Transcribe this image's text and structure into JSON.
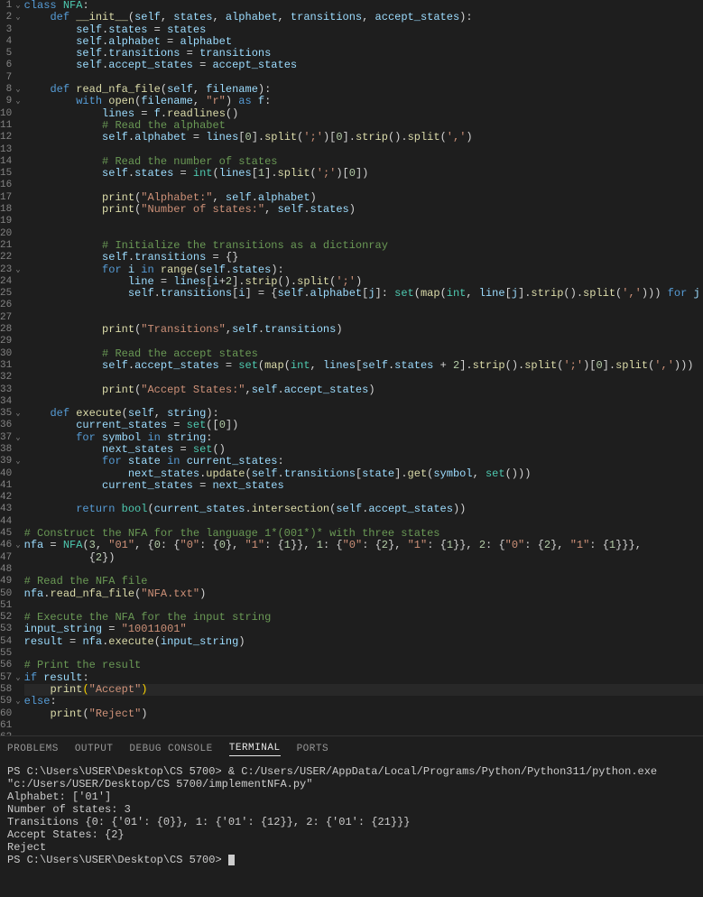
{
  "gutter_lines": 62,
  "fold_lines": [
    1,
    2,
    8,
    9,
    23,
    35,
    37,
    39,
    46,
    57,
    59
  ],
  "code_lines": [
    "<span class='kw'>class</span> <span class='cls'>NFA</span>:",
    "    <span class='kw'>def</span> <span class='fn'>__init__</span>(<span class='self'>self</span>, <span class='var'>states</span>, <span class='var'>alphabet</span>, <span class='var'>transitions</span>, <span class='var'>accept_states</span>):",
    "        <span class='self'>self</span>.<span class='var'>states</span> = <span class='var'>states</span>",
    "        <span class='self'>self</span>.<span class='var'>alphabet</span> = <span class='var'>alphabet</span>",
    "        <span class='self'>self</span>.<span class='var'>transitions</span> = <span class='var'>transitions</span>",
    "        <span class='self'>self</span>.<span class='var'>accept_states</span> = <span class='var'>accept_states</span>",
    "",
    "    <span class='kw'>def</span> <span class='fn'>read_nfa_file</span>(<span class='self'>self</span>, <span class='var'>filename</span>):",
    "        <span class='kw'>with</span> <span class='fn'>open</span>(<span class='var'>filename</span>, <span class='str'>\"r\"</span>) <span class='kw'>as</span> <span class='var'>f</span>:",
    "            <span class='var'>lines</span> = <span class='var'>f</span>.<span class='fn'>readlines</span>()",
    "            <span class='cmt'># Read the alphabet</span>",
    "            <span class='self'>self</span>.<span class='var'>alphabet</span> = <span class='var'>lines</span>[<span class='num'>0</span>].<span class='fn'>split</span>(<span class='str'>';'</span>)[<span class='num'>0</span>].<span class='fn'>strip</span>().<span class='fn'>split</span>(<span class='str'>','</span>)",
    "",
    "            <span class='cmt'># Read the number of states</span>",
    "            <span class='self'>self</span>.<span class='var'>states</span> = <span class='builtin'>int</span>(<span class='var'>lines</span>[<span class='num'>1</span>].<span class='fn'>split</span>(<span class='str'>';'</span>)[<span class='num'>0</span>])",
    "",
    "            <span class='fn'>print</span>(<span class='str'>\"Alphabet:\"</span>, <span class='self'>self</span>.<span class='var'>alphabet</span>)",
    "            <span class='fn'>print</span>(<span class='str'>\"Number of states:\"</span>, <span class='self'>self</span>.<span class='var'>states</span>)",
    "",
    "",
    "            <span class='cmt'># Initialize the transitions as a dictionray</span>",
    "            <span class='self'>self</span>.<span class='var'>transitions</span> = {}",
    "            <span class='kw'>for</span> <span class='var'>i</span> <span class='kw'>in</span> <span class='fn'>range</span>(<span class='self'>self</span>.<span class='var'>states</span>):",
    "                <span class='var'>line</span> = <span class='var'>lines</span>[<span class='var'>i</span>+<span class='num'>2</span>].<span class='fn'>strip</span>().<span class='fn'>split</span>(<span class='str'>';'</span>)",
    "                <span class='self'>self</span>.<span class='var'>transitions</span>[<span class='var'>i</span>] = {<span class='self'>self</span>.<span class='var'>alphabet</span>[<span class='var'>j</span>]: <span class='builtin'>set</span>(<span class='fn'>map</span>(<span class='builtin'>int</span>, <span class='var'>line</span>[<span class='var'>j</span>].<span class='fn'>strip</span>().<span class='fn'>split</span>(<span class='str'>','</span>))) <span class='kw'>for</span> <span class='var'>j</span> <span class='kw'>in</span> <span class='fn'>range</span>(<span class='fn'>len</span>(<span class='self'>self</span>.<span class='var'>alphabet</span>))}",
    "",
    "",
    "            <span class='fn'>print</span>(<span class='str'>\"Transitions\"</span>,<span class='self'>self</span>.<span class='var'>transitions</span>)",
    "",
    "            <span class='cmt'># Read the accept states</span>",
    "            <span class='self'>self</span>.<span class='var'>accept_states</span> = <span class='builtin'>set</span>(<span class='fn'>map</span>(<span class='builtin'>int</span>, <span class='var'>lines</span>[<span class='self'>self</span>.<span class='var'>states</span> + <span class='num'>2</span>].<span class='fn'>strip</span>().<span class='fn'>split</span>(<span class='str'>';'</span>)[<span class='num'>0</span>].<span class='fn'>split</span>(<span class='str'>','</span>)))",
    "",
    "            <span class='fn'>print</span>(<span class='str'>\"Accept States:\"</span>,<span class='self'>self</span>.<span class='var'>accept_states</span>)",
    "",
    "    <span class='kw'>def</span> <span class='fn'>execute</span>(<span class='self'>self</span>, <span class='var'>string</span>):",
    "        <span class='var'>current_states</span> = <span class='builtin'>set</span>([<span class='num'>0</span>])",
    "        <span class='kw'>for</span> <span class='var'>symbol</span> <span class='kw'>in</span> <span class='var'>string</span>:",
    "            <span class='var'>next_states</span> = <span class='builtin'>set</span>()",
    "            <span class='kw'>for</span> <span class='var'>state</span> <span class='kw'>in</span> <span class='var'>current_states</span>:",
    "                <span class='var'>next_states</span>.<span class='fn'>update</span>(<span class='self'>self</span>.<span class='var'>transitions</span>[<span class='var'>state</span>].<span class='fn'>get</span>(<span class='var'>symbol</span>, <span class='builtin'>set</span>()))",
    "            <span class='var'>current_states</span> = <span class='var'>next_states</span>",
    "",
    "        <span class='kw'>return</span> <span class='builtin'>bool</span>(<span class='var'>current_states</span>.<span class='fn'>intersection</span>(<span class='self'>self</span>.<span class='var'>accept_states</span>))",
    "",
    "<span class='cmt'># Construct the NFA for the language 1*(001*)* with three states</span>",
    "<span class='var'>nfa</span> = <span class='cls'>NFA</span>(<span class='num'>3</span>, <span class='str'>\"01\"</span>, {<span class='num'>0</span>: {<span class='str'>\"0\"</span>: {<span class='num'>0</span>}, <span class='str'>\"1\"</span>: {<span class='num'>1</span>}}, <span class='num'>1</span>: {<span class='str'>\"0\"</span>: {<span class='num'>2</span>}, <span class='str'>\"1\"</span>: {<span class='num'>1</span>}}, <span class='num'>2</span>: {<span class='str'>\"0\"</span>: {<span class='num'>2</span>}, <span class='str'>\"1\"</span>: {<span class='num'>1</span>}}},",
    "          {<span class='num'>2</span>})",
    "",
    "<span class='cmt'># Read the NFA file</span>",
    "<span class='var'>nfa</span>.<span class='fn'>read_nfa_file</span>(<span class='str'>\"NFA.txt\"</span>)",
    "",
    "<span class='cmt'># Execute the NFA for the input string</span>",
    "<span class='var'>input_string</span> = <span class='str'>\"10011001\"</span>",
    "<span class='var'>result</span> = <span class='var'>nfa</span>.<span class='fn'>execute</span>(<span class='var'>input_string</span>)",
    "",
    "<span class='cmt'># Print the result</span>",
    "<span class='kw'>if</span> <span class='var'>result</span>:",
    "    <span class='fn'>print</span><span class='paren'>(</span><span class='str'>\"Accept\"</span><span class='paren'>)</span>",
    "<span class='kw'>else</span>:",
    "    <span class='fn'>print</span>(<span class='str'>\"Reject\"</span>)",
    "",
    ""
  ],
  "cursor_line": 58,
  "tabs": {
    "problems": "PROBLEMS",
    "output": "OUTPUT",
    "debug": "DEBUG CONSOLE",
    "terminal": "TERMINAL",
    "ports": "PORTS"
  },
  "terminal_lines": [
    "PS C:\\Users\\USER\\Desktop\\CS 5700> & C:/Users/USER/AppData/Local/Programs/Python/Python311/python.exe \"c:/Users/USER/Desktop/CS 5700/implementNFA.py\"",
    "Alphabet: ['01']",
    "Number of states: 3",
    "Transitions {0: {'01': {0}}, 1: {'01': {12}}, 2: {'01': {21}}}",
    "Accept States: {2}",
    "Reject",
    "PS C:\\Users\\USER\\Desktop\\CS 5700> "
  ]
}
